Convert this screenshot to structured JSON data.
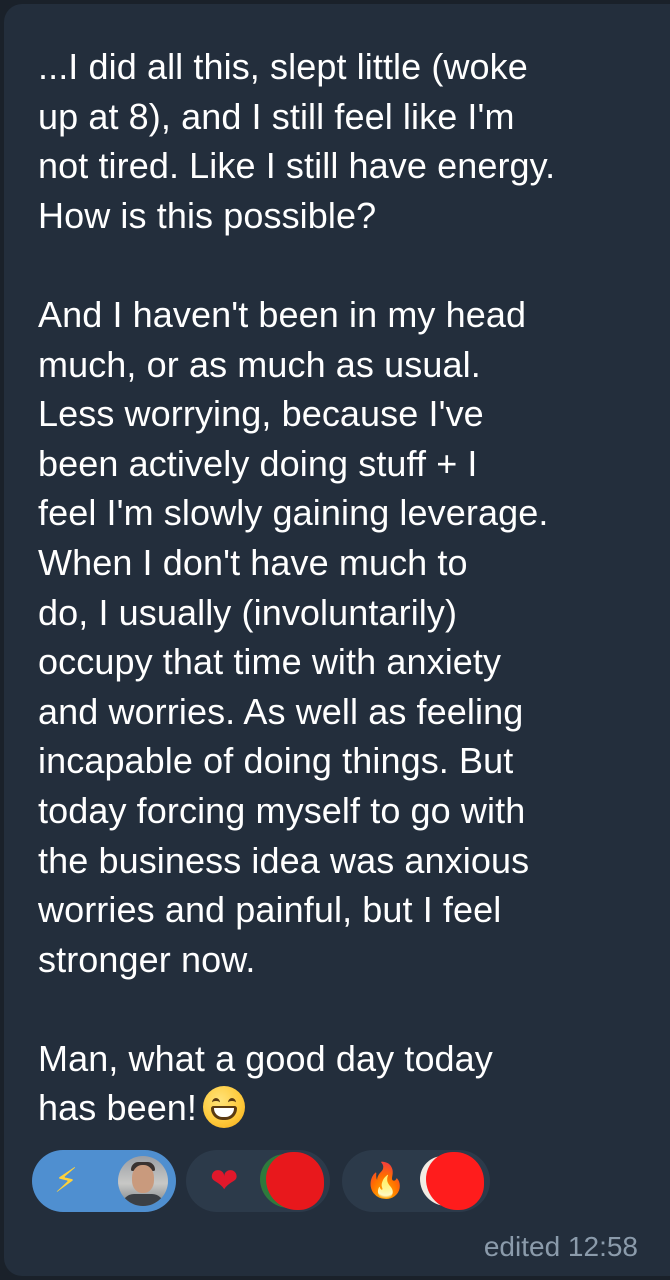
{
  "message": {
    "lines": [
      "...I did all this, slept little (woke",
      "up at 8), and I still feel like I'm",
      "not tired. Like I still have energy.",
      "How is this possible?",
      "",
      "And I haven't been in my head",
      "much, or as much as usual.",
      "Less worrying, because I've",
      "been actively doing stuff + I",
      "feel I'm slowly gaining leverage.",
      "When I don't have much to",
      "do, I usually (involuntarily)",
      "occupy that time with anxiety",
      "and worries. As well as feeling",
      "incapable of doing things. But",
      "today forcing myself to go with",
      "the business idea was anxious",
      "worries and painful, but I feel",
      "stronger now.",
      "",
      "Man, what a good day today",
      "has been!"
    ],
    "end_emoji": "grinning-face-emoji"
  },
  "reactions": [
    {
      "emoji": "⚡",
      "icon": "lightning-icon",
      "selected": true
    },
    {
      "emoji": "❤",
      "icon": "heart-icon",
      "selected": false
    },
    {
      "emoji": "🔥",
      "icon": "fire-icon",
      "selected": false
    }
  ],
  "meta": {
    "status": "edited 12:58"
  },
  "colors": {
    "background": "#1a212a",
    "bubble": "#232e3c",
    "text": "#ffffff",
    "meta_text": "#8b9bab",
    "reaction_selected": "#4f8fd0",
    "reaction_default": "#2c3a4a"
  }
}
